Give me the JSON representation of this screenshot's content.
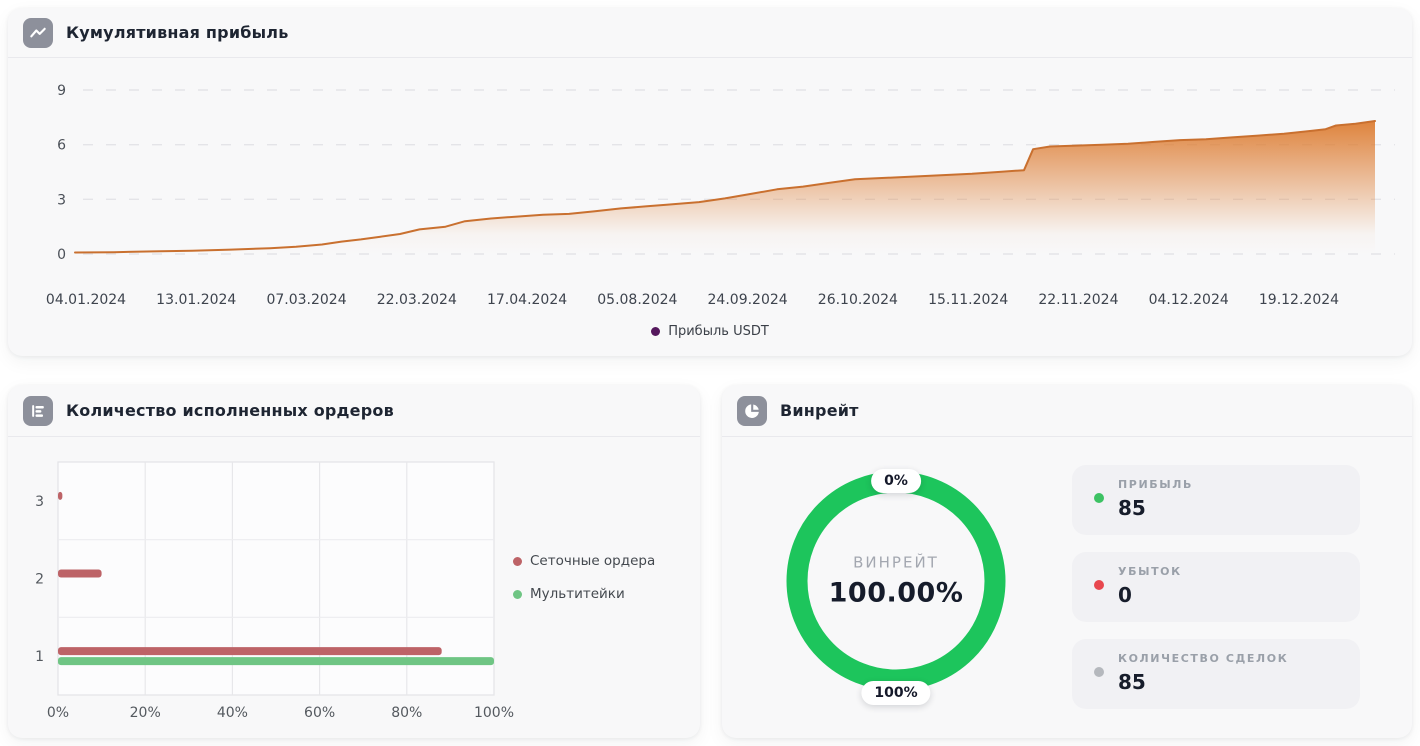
{
  "icons": {
    "profit_panel": "line-chart-icon",
    "orders_panel": "bar-chart-icon",
    "winrate_panel": "pie-chart-icon"
  },
  "chart_data": [
    {
      "id": "cumulative_profit",
      "type": "area",
      "title": "Кумулятивная прибыль",
      "series_name": "Прибыль USDT",
      "legend_dot_color": "#55185d",
      "line_color": "#c9702f",
      "fill_color": "#dd7d33",
      "grid": "dashed-horizontal",
      "ylim": [
        0,
        9
      ],
      "yticks": [
        "9",
        "6",
        "3",
        "0"
      ],
      "x_labels": [
        "04.01.2024",
        "13.01.2024",
        "07.03.2024",
        "22.03.2024",
        "17.04.2024",
        "05.08.2024",
        "24.09.2024",
        "26.10.2024",
        "15.11.2024",
        "22.11.2024",
        "04.12.2024",
        "19.12.2024"
      ],
      "x_fraction": [
        0,
        0.03,
        0.06,
        0.09,
        0.12,
        0.15,
        0.17,
        0.19,
        0.205,
        0.22,
        0.235,
        0.25,
        0.265,
        0.285,
        0.3,
        0.32,
        0.34,
        0.36,
        0.38,
        0.4,
        0.42,
        0.44,
        0.455,
        0.48,
        0.5,
        0.52,
        0.54,
        0.56,
        0.58,
        0.6,
        0.63,
        0.66,
        0.69,
        0.71,
        0.73,
        0.737,
        0.75,
        0.77,
        0.79,
        0.81,
        0.83,
        0.85,
        0.87,
        0.89,
        0.91,
        0.93,
        0.95,
        0.962,
        0.97,
        0.985,
        1.0
      ],
      "values": [
        0.08,
        0.1,
        0.14,
        0.18,
        0.24,
        0.32,
        0.4,
        0.52,
        0.68,
        0.8,
        0.95,
        1.1,
        1.35,
        1.5,
        1.8,
        1.95,
        2.05,
        2.15,
        2.2,
        2.35,
        2.5,
        2.62,
        2.7,
        2.85,
        3.05,
        3.3,
        3.55,
        3.7,
        3.9,
        4.1,
        4.2,
        4.3,
        4.4,
        4.5,
        4.6,
        5.75,
        5.9,
        5.95,
        6.0,
        6.05,
        6.15,
        6.25,
        6.3,
        6.4,
        6.5,
        6.6,
        6.75,
        6.85,
        7.05,
        7.15,
        7.3
      ]
    },
    {
      "id": "executed_orders",
      "type": "bar",
      "orientation": "horizontal",
      "title": "Количество исполненных ордеров",
      "categories": [
        "3",
        "2",
        "1"
      ],
      "series": [
        {
          "name": "Сеточные ордера",
          "color": "#bd6367",
          "values": [
            1,
            10,
            88
          ]
        },
        {
          "name": "Мультитейки",
          "color": "#6fc584",
          "values": [
            0,
            0,
            100
          ]
        }
      ],
      "xlim": [
        0,
        100
      ],
      "x_ticks": [
        "0%",
        "20%",
        "40%",
        "60%",
        "80%",
        "100%"
      ],
      "legend_position": "right"
    },
    {
      "id": "winrate",
      "type": "donut",
      "title": "Винрейт",
      "ring_color": "#1dc55c",
      "value_pct": 100,
      "center_label": "ВИНРЕЙТ",
      "center_value": "100.00%",
      "top_badge": "0%",
      "bottom_badge": "100%",
      "stats": [
        {
          "label": "ПРИБЫЛЬ",
          "value": "85",
          "dot_color": "#3dc263"
        },
        {
          "label": "УБЫТОК",
          "value": "0",
          "dot_color": "#e8474e"
        },
        {
          "label": "КОЛИЧЕСТВО СДЕЛОК",
          "value": "85",
          "dot_color": "#b5b8bd"
        }
      ]
    }
  ]
}
